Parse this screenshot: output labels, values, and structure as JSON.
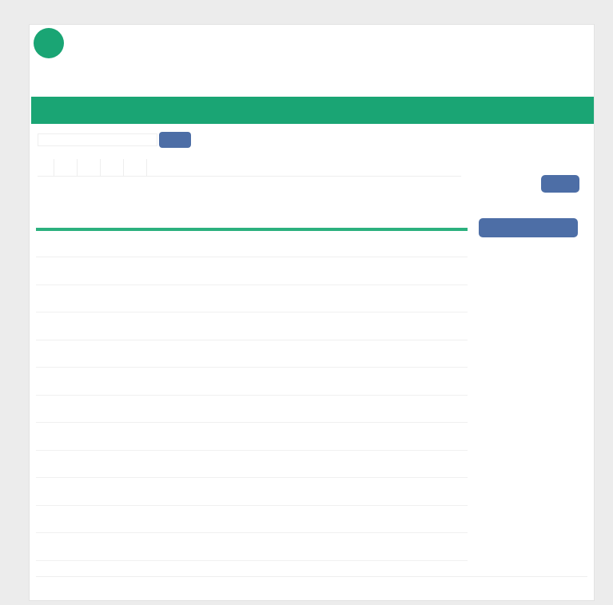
{
  "header": {
    "app_name": "",
    "top_right": "",
    "user_link": "",
    "user_close": ""
  },
  "breadcrumb": {
    "item1": "",
    "item2": ""
  },
  "subline": {
    "item1": "",
    "item2": "",
    "item3": ""
  },
  "navbar": {
    "items": [
      "",
      "",
      "",
      "",
      ""
    ]
  },
  "filter": {
    "placeholder": "",
    "button_label": "",
    "count_text": ""
  },
  "tabs": [
    "",
    "",
    "",
    "",
    ""
  ],
  "table": {
    "headers": [
      "",
      "",
      "",
      "",
      "",
      "",
      "",
      "",
      "",
      ""
    ],
    "rows": [
      [
        "",
        "",
        "",
        "",
        "",
        "",
        "",
        "",
        "",
        ""
      ],
      [
        "",
        "",
        "",
        "",
        "",
        "",
        "",
        "",
        "",
        ""
      ],
      [
        "",
        "",
        "",
        "",
        "",
        "",
        "",
        "",
        "",
        ""
      ],
      [
        "",
        "",
        "",
        "",
        "",
        "",
        "",
        "",
        "",
        ""
      ],
      [
        "",
        "",
        "",
        "",
        "",
        "",
        "",
        "",
        "",
        ""
      ],
      [
        "",
        "",
        "",
        "",
        "",
        "",
        "",
        "",
        "",
        ""
      ],
      [
        "",
        "",
        "",
        "",
        "",
        "",
        "",
        "",
        "",
        ""
      ],
      [
        "",
        "",
        "",
        "",
        "",
        "",
        "",
        "",
        "",
        ""
      ],
      [
        "",
        "",
        "",
        "",
        "",
        "",
        "",
        "",
        "",
        ""
      ],
      [
        "",
        "",
        "",
        "",
        "",
        "",
        "",
        "",
        "",
        ""
      ],
      [
        "",
        "",
        "",
        "",
        "",
        "",
        "",
        "",
        "",
        ""
      ],
      [
        "",
        "",
        "",
        "",
        "",
        "",
        "",
        "",
        "",
        ""
      ]
    ]
  },
  "sidebar": {
    "section1_title": "",
    "row1_label": "",
    "row1_value": "",
    "row2_label": "",
    "row2_value": "",
    "small_button": "",
    "link1": "",
    "section2_title": "",
    "row3_value": "",
    "link2": "",
    "big_button": "",
    "section3_title": "",
    "link3": ""
  },
  "footer": {
    "center": "",
    "right": ""
  },
  "colors": {
    "nav_green": "#1aa574",
    "button_blue": "#4d6ea6",
    "link_blue": "#3a6aa8",
    "alert_red": "#cc4444"
  }
}
